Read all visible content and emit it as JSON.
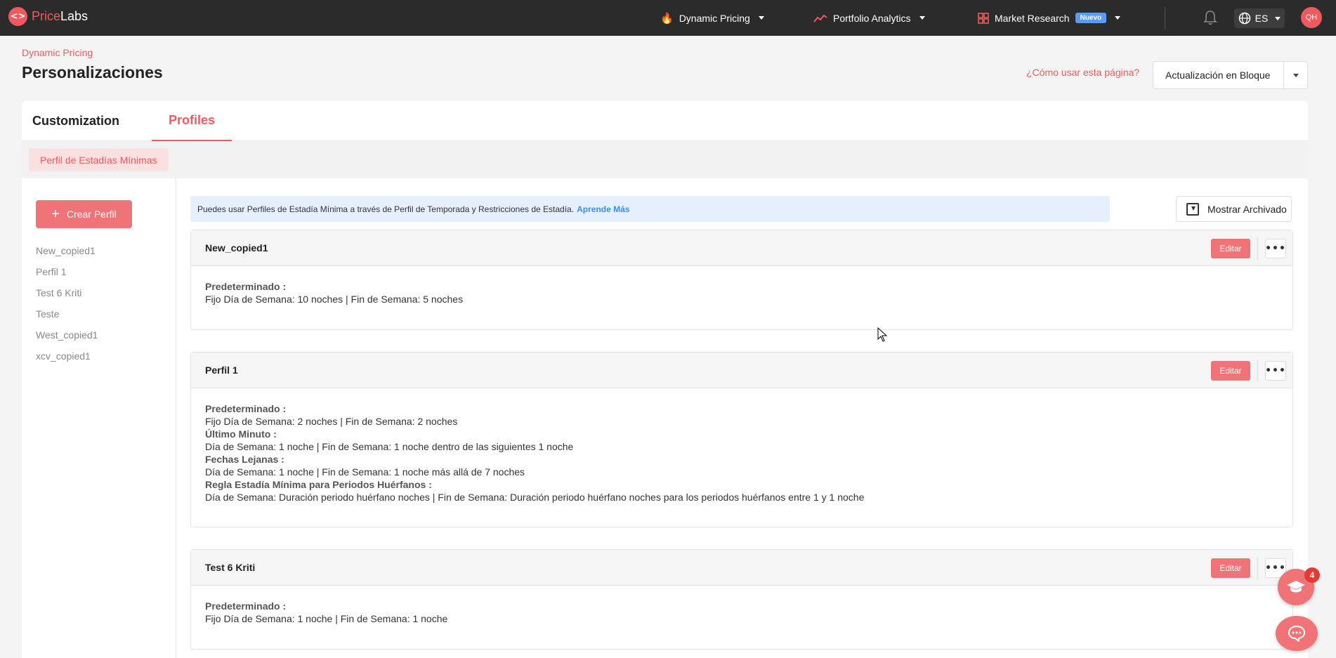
{
  "nav": {
    "brand_a": "Price",
    "brand_b": "Labs",
    "items": [
      {
        "label": "Dynamic Pricing",
        "icon": "flame-icon"
      },
      {
        "label": "Portfolio Analytics",
        "icon": "trend-icon"
      },
      {
        "label": "Market Research",
        "icon": "grid-icon",
        "badge": "Nuevo"
      }
    ],
    "language": "ES",
    "avatar_initials": "QH"
  },
  "header": {
    "breadcrumb": "Dynamic Pricing",
    "title": "Personalizaciones",
    "help_link": "¿Cómo usar esta página?",
    "bulk_update": "Actualización en Bloque"
  },
  "tabs": [
    {
      "label": "Customization",
      "active": false
    },
    {
      "label": "Profiles",
      "active": true
    }
  ],
  "subtab": "Perfil de Estadías Mínimas",
  "sidebar": {
    "create_button": "Crear Perfil",
    "profiles": [
      "New_copied1",
      "Perfil 1",
      "Test 6 Kriti",
      "Teste",
      "West_copied1",
      "xcv_copied1"
    ]
  },
  "info": {
    "text": "Puedes usar Perfiles de Estadía Mínima a través de Perfil de Temporada y Restricciones de Estadía.",
    "learn_more": "Aprende Más",
    "archive_button": "Mostrar Archivado"
  },
  "profiles": [
    {
      "name": "New_copied1",
      "edit": "Editar",
      "lines": [
        {
          "label": "Predeterminado :",
          "text": "Fijo Día de Semana: 10 noches | Fin de Semana: 5 noches"
        }
      ]
    },
    {
      "name": "Perfil 1",
      "edit": "Editar",
      "lines": [
        {
          "label": "Predeterminado :",
          "text": "Fijo Día de Semana: 2 noches | Fin de Semana: 2 noches"
        },
        {
          "label": "Último Minuto :",
          "text": "Día de Semana: 1 noche | Fin de Semana: 1 noche dentro de las siguientes 1 noche"
        },
        {
          "label": "Fechas Lejanas :",
          "text": "Día de Semana: 1 noche | Fin de Semana: 1 noche más allá de 7 noches"
        },
        {
          "label": "Regla Estadía Mínima para Periodos Huérfanos :",
          "text": "Día de Semana: Duración periodo huérfano noches | Fin de Semana: Duración periodo huérfano noches para los periodos huérfanos entre 1 y 1 noche"
        }
      ]
    },
    {
      "name": "Test 6 Kriti",
      "edit": "Editar",
      "lines": [
        {
          "label": "Predeterminado :",
          "text": "Fijo Día de Semana: 1 noche | Fin de Semana: 1 noche"
        }
      ]
    }
  ],
  "notifications_count": "4",
  "colors": {
    "accent": "#f05a5e",
    "nav_bg": "#2b2b2b",
    "info_bg": "#e6effc",
    "badge_blue": "#5b9cf2"
  }
}
